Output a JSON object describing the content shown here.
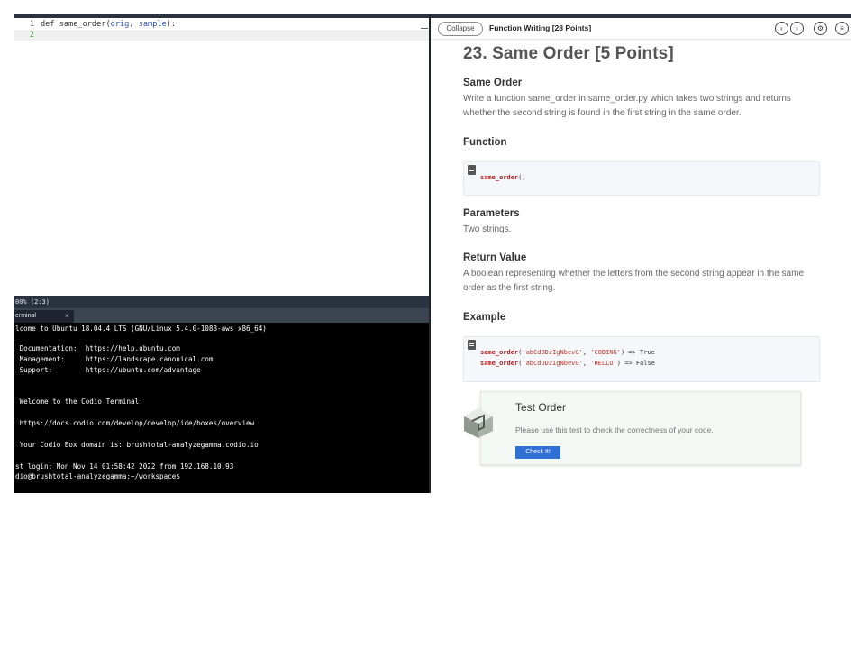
{
  "editor": {
    "lines": [
      {
        "num": "1",
        "kw": "def ",
        "fn": "same_order",
        "open": "(",
        "p1": "orig",
        "sep": ", ",
        "p2": "sample",
        "close": "):"
      },
      {
        "num": "2"
      }
    ]
  },
  "status": {
    "text": "00% (2:3)"
  },
  "terminal": {
    "tab_label": "erminal",
    "tab_close": "×",
    "lines": [
      "lcome to Ubuntu 18.04.4 LTS (GNU/Linux 5.4.0-1088-aws x86_64)",
      "",
      " Documentation:  https://help.ubuntu.com",
      " Management:     https://landscape.canonical.com",
      " Support:        https://ubuntu.com/advantage",
      "",
      "",
      " Welcome to the Codio Terminal:",
      "",
      " https://docs.codio.com/develop/develop/ide/boxes/overview",
      "",
      " Your Codio Box domain is: brushtotal-analyzegamma.codio.io",
      "",
      "st login: Mon Nov 14 01:58:42 2022 from 192.168.10.93",
      "dio@brushtotal-analyzegamma:~/workspace$"
    ]
  },
  "guide": {
    "collapse_label": "Collapse",
    "header_title": "Function Writing [28 Points]",
    "icons": {
      "prev": "‹",
      "next": "›",
      "settings": "⚙",
      "menu": "≡"
    },
    "title": "23. Same Order [5 Points]",
    "section1": {
      "heading": "Same Order",
      "body": "Write a function same_order in same_order.py which takes two strings and returns whether the second string is found in the first string in the same order."
    },
    "function": {
      "heading": "Function",
      "code_fn": "same_order",
      "code_rest": "()"
    },
    "parameters": {
      "heading": "Parameters",
      "body": "Two strings."
    },
    "return_value": {
      "heading": "Return Value",
      "body": "A boolean representing whether the letters from the second string appear in the same order as the first string."
    },
    "example": {
      "heading": "Example",
      "lines": [
        {
          "fn": "same_order",
          "a": "(",
          "s1": "'abCdODzIgNbevG'",
          "b": ", ",
          "s2": "'CODING'",
          "c": ") => True"
        },
        {
          "fn": "same_order",
          "a": "(",
          "s1": "'abCdODzIgNbevG'",
          "b": ", ",
          "s2": "'HELLO'",
          "c": ") => False"
        }
      ]
    },
    "test": {
      "title": "Test Order",
      "description": "Please use this test to check the correctness of your code.",
      "button": "Check It!"
    }
  }
}
